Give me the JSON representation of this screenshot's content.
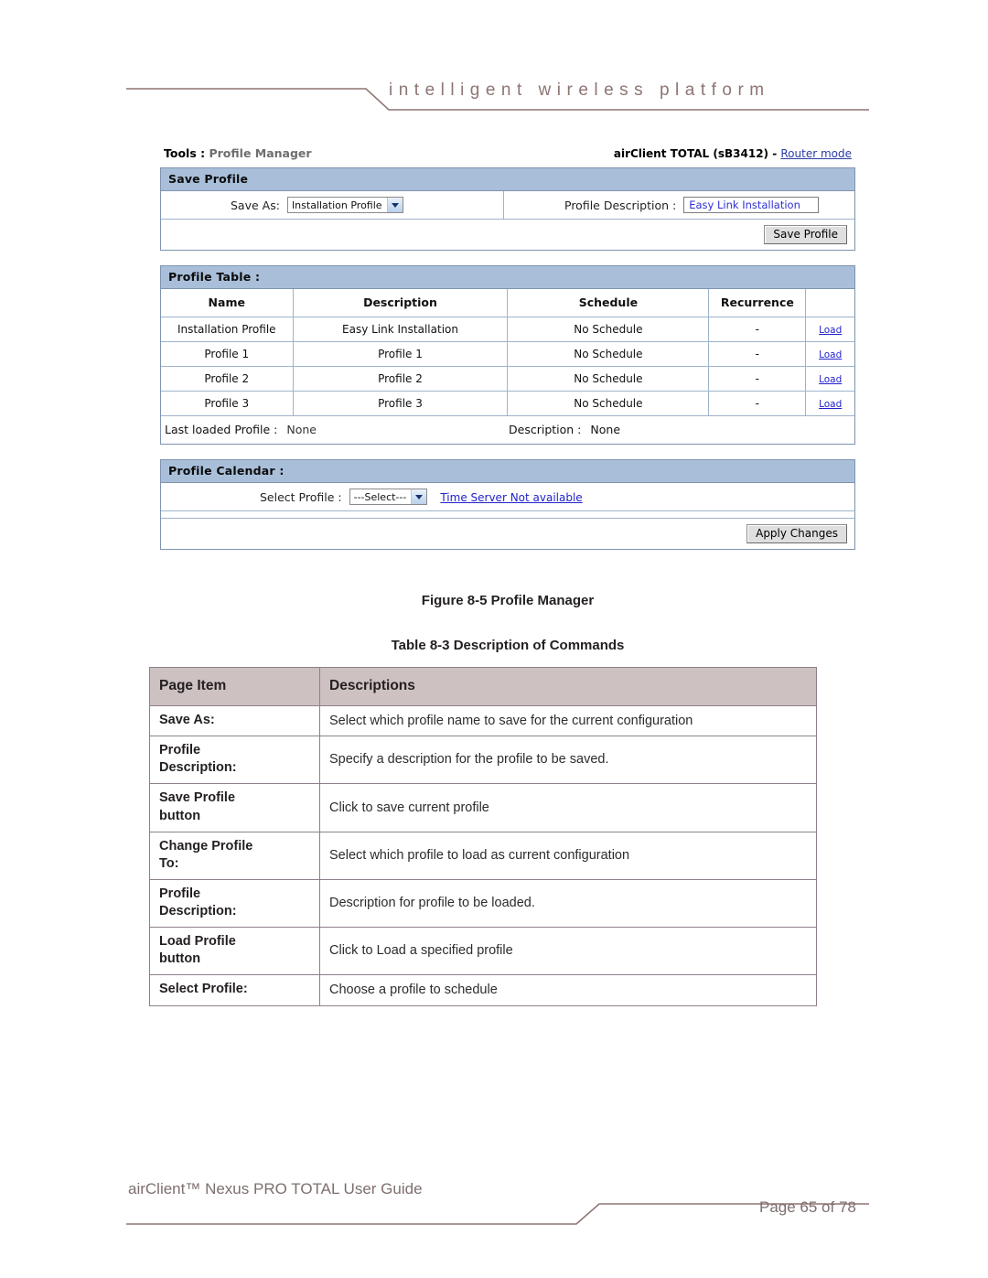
{
  "header": {
    "tagline": "intelligent   wireless   platform"
  },
  "screenshot": {
    "breadcrumb_prefix": "Tools : ",
    "breadcrumb_page": "Profile Manager",
    "device_label": "airClient TOTAL (sB3412) - ",
    "mode_link": "Router mode",
    "save_profile": {
      "title": "Save Profile",
      "save_as_label": "Save As:",
      "save_as_value": "Installation Profile",
      "description_label": "Profile Description :",
      "description_value": "Easy Link Installation",
      "save_button": "Save Profile"
    },
    "profile_table": {
      "title": "Profile Table :",
      "columns": [
        "Name",
        "Description",
        "Schedule",
        "Recurrence",
        ""
      ],
      "rows": [
        {
          "name": "Installation Profile",
          "description": "Easy Link Installation",
          "schedule": "No Schedule",
          "recurrence": "-",
          "action": "Load"
        },
        {
          "name": "Profile 1",
          "description": "Profile 1",
          "schedule": "No Schedule",
          "recurrence": "-",
          "action": "Load"
        },
        {
          "name": "Profile 2",
          "description": "Profile 2",
          "schedule": "No Schedule",
          "recurrence": "-",
          "action": "Load"
        },
        {
          "name": "Profile 3",
          "description": "Profile 3",
          "schedule": "No Schedule",
          "recurrence": "-",
          "action": "Load"
        }
      ],
      "last_loaded_label": "Last loaded Profile :",
      "last_loaded_value": "None",
      "last_desc_label": "Description :",
      "last_desc_value": "None"
    },
    "profile_calendar": {
      "title": "Profile Calendar :",
      "select_label": "Select Profile :",
      "select_value": "---Select---",
      "time_server_link": "Time Server Not available",
      "apply_button": "Apply Changes"
    },
    "colors": {
      "panel_header_bg": "#a9bfd9",
      "panel_border": "#7e93b0",
      "link_blue": "#2222cc",
      "input_text_blue": "#2f2fd4"
    }
  },
  "figure_caption": "Figure 8-5 Profile Manager",
  "table_caption": "Table 8-3 Description of Commands",
  "commands_table": {
    "headers": [
      "Page Item",
      "Descriptions"
    ],
    "header_bg": "#cdc1c1",
    "rows": [
      {
        "item": "Save As:",
        "description": "Select which profile name to save for the current configuration"
      },
      {
        "item": "Profile\nDescription:",
        "description": "Specify a description for the profile to be saved."
      },
      {
        "item": "Save Profile\nbutton",
        "description": "Click to save current profile"
      },
      {
        "item": "Change Profile\nTo:",
        "description": "Select which profile to load as current configuration"
      },
      {
        "item": "Profile\nDescription:",
        "description": "Description for profile to be loaded."
      },
      {
        "item": "Load Profile\nbutton",
        "description": "Click to Load a specified profile"
      },
      {
        "item": "Select Profile:",
        "description": "Choose a profile to schedule"
      }
    ]
  },
  "footer": {
    "left": "airClient™ Nexus PRO TOTAL User Guide",
    "right": "Page 65 of 78"
  }
}
